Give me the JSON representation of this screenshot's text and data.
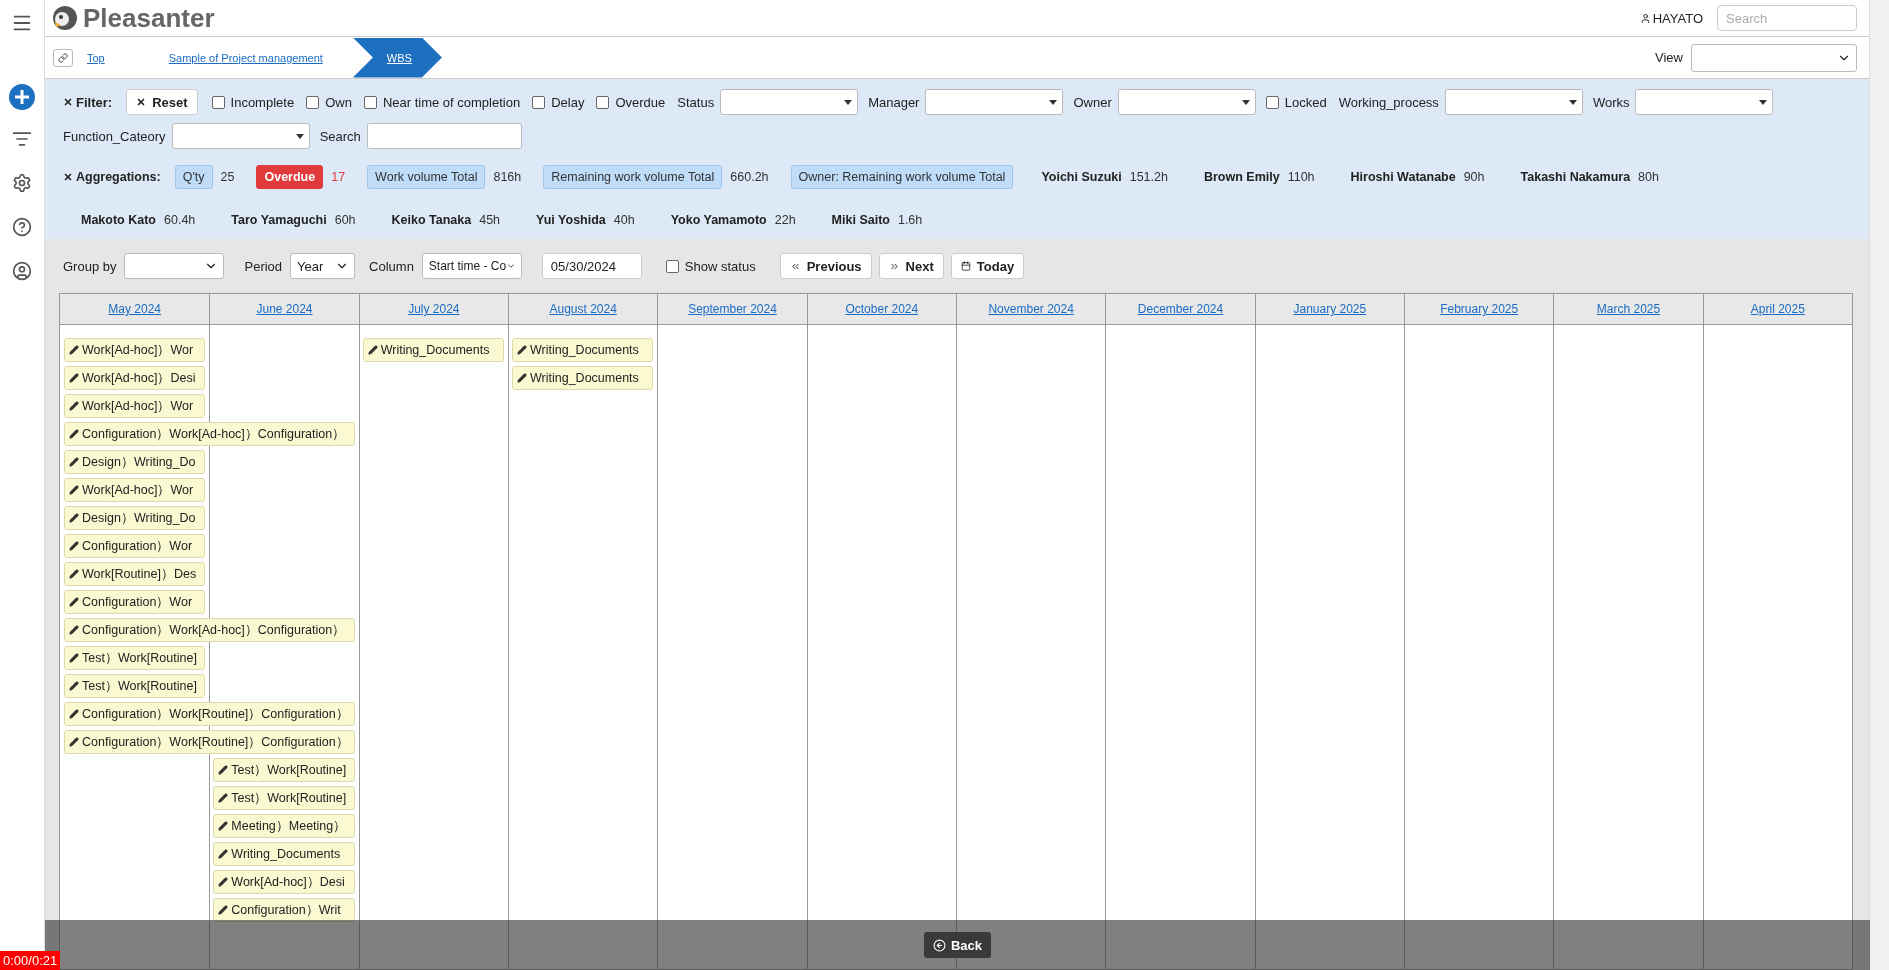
{
  "header": {
    "logo": "Pleasanter",
    "user": "HAYATO",
    "search_placeholder": "Search"
  },
  "breadcrumb": [
    {
      "label": "Top",
      "selected": false
    },
    {
      "label": "Sample of Project management",
      "selected": false
    },
    {
      "label": "WBS",
      "selected": true
    }
  ],
  "view": {
    "label": "View"
  },
  "filter": {
    "title": "Filter:",
    "reset": "Reset",
    "controls": [
      {
        "kind": "checkbox",
        "label": "Incomplete",
        "checked": false
      },
      {
        "kind": "checkbox",
        "label": "Own",
        "checked": false
      },
      {
        "kind": "checkbox",
        "label": "Near time of completion",
        "checked": false
      },
      {
        "kind": "checkbox",
        "label": "Delay",
        "checked": false
      },
      {
        "kind": "checkbox",
        "label": "Overdue",
        "checked": false
      },
      {
        "kind": "select",
        "label": "Status"
      },
      {
        "kind": "select",
        "label": "Manager"
      },
      {
        "kind": "select",
        "label": "Owner"
      },
      {
        "kind": "checkbox",
        "label": "Locked",
        "checked": false
      },
      {
        "kind": "select",
        "label": "Working_process"
      },
      {
        "kind": "select",
        "label": "Works"
      },
      {
        "kind": "select",
        "label": "Function_Cateory"
      },
      {
        "kind": "text",
        "label": "Search"
      }
    ]
  },
  "aggregations": {
    "title": "Aggregations:",
    "items": [
      {
        "kind": "tag",
        "label": "Q'ty",
        "value": "25"
      },
      {
        "kind": "alert",
        "label": "Overdue",
        "value": "17"
      },
      {
        "kind": "tag",
        "label": "Work volume Total",
        "value": "816h"
      },
      {
        "kind": "tag",
        "label": "Remaining work volume Total",
        "value": "660.2h"
      },
      {
        "kind": "tag",
        "label": "Owner: Remaining work volume Total",
        "value": ""
      },
      {
        "kind": "owner",
        "label": "Yoichi Suzuki",
        "value": "151.2h"
      },
      {
        "kind": "owner",
        "label": "Brown Emily",
        "value": "110h"
      },
      {
        "kind": "owner",
        "label": "Hiroshi Watanabe",
        "value": "90h"
      },
      {
        "kind": "owner",
        "label": "Takashi Nakamura",
        "value": "80h"
      },
      {
        "kind": "owner",
        "label": "Makoto Kato",
        "value": "60.4h"
      },
      {
        "kind": "owner",
        "label": "Taro Yamaguchi",
        "value": "60h"
      },
      {
        "kind": "owner",
        "label": "Keiko Tanaka",
        "value": "45h"
      },
      {
        "kind": "owner",
        "label": "Yui Yoshida",
        "value": "40h"
      },
      {
        "kind": "owner",
        "label": "Yoko Yamamoto",
        "value": "22h"
      },
      {
        "kind": "owner",
        "label": "Miki Saito",
        "value": "1.6h"
      }
    ]
  },
  "toolbar": {
    "group_by": {
      "label": "Group by"
    },
    "period": {
      "label": "Period",
      "value": "Year"
    },
    "column": {
      "label": "Column",
      "value": "Start time - Co"
    },
    "date": "05/30/2024",
    "show_status": {
      "label": "Show status",
      "checked": false
    },
    "buttons": [
      {
        "kind": "previous",
        "label": "Previous"
      },
      {
        "kind": "next",
        "label": "Next"
      },
      {
        "kind": "today",
        "label": "Today"
      }
    ]
  },
  "calendar": {
    "months": [
      "May 2024",
      "June 2024",
      "July 2024",
      "August 2024",
      "September 2024",
      "October 2024",
      "November 2024",
      "December 2024",
      "January 2025",
      "February 2025",
      "March 2025",
      "April 2025"
    ],
    "rows": [
      [
        {
          "kind": "single",
          "text": "Work[Ad-hoc]）Wor"
        },
        {
          "kind": "empty"
        },
        {
          "kind": "single",
          "text": "Writing_Documents"
        },
        {
          "kind": "single",
          "text": "Writing_Documents"
        }
      ],
      [
        {
          "kind": "single",
          "text": "Work[Ad-hoc]）Desi"
        },
        {
          "kind": "empty"
        },
        {
          "kind": "empty"
        },
        {
          "kind": "single",
          "text": "Writing_Documents"
        }
      ],
      [
        {
          "kind": "single",
          "text": "Work[Ad-hoc]）Wor"
        }
      ],
      [
        {
          "kind": "double",
          "text": "Configuration）Work[Ad-hoc]）Configuration）"
        }
      ],
      [
        {
          "kind": "single",
          "text": "Design）Writing_Do"
        }
      ],
      [
        {
          "kind": "single",
          "text": "Work[Ad-hoc]）Wor"
        }
      ],
      [
        {
          "kind": "single",
          "text": "Design）Writing_Do"
        }
      ],
      [
        {
          "kind": "single",
          "text": "Configuration）Wor"
        }
      ],
      [
        {
          "kind": "single",
          "text": "Work[Routine]）Des"
        }
      ],
      [
        {
          "kind": "single",
          "text": "Configuration）Wor"
        }
      ],
      [
        {
          "kind": "double",
          "text": "Configuration）Work[Ad-hoc]）Configuration）"
        }
      ],
      [
        {
          "kind": "single",
          "text": "Test）Work[Routine]"
        }
      ],
      [
        {
          "kind": "single",
          "text": "Test）Work[Routine]"
        }
      ],
      [
        {
          "kind": "double",
          "text": "Configuration）Work[Routine]）Configuration）"
        }
      ],
      [
        {
          "kind": "double",
          "text": "Configuration）Work[Routine]）Configuration）"
        }
      ],
      [
        {
          "kind": "empty"
        },
        {
          "kind": "single",
          "text": "Test）Work[Routine]"
        }
      ],
      [
        {
          "kind": "empty"
        },
        {
          "kind": "single",
          "text": "Test）Work[Routine]"
        }
      ],
      [
        {
          "kind": "empty"
        },
        {
          "kind": "single",
          "text": "Meeting）Meeting）"
        }
      ],
      [
        {
          "kind": "empty"
        },
        {
          "kind": "single",
          "text": "Writing_Documents"
        }
      ],
      [
        {
          "kind": "empty"
        },
        {
          "kind": "single",
          "text": "Work[Ad-hoc]）Desi"
        }
      ],
      [
        {
          "kind": "empty"
        },
        {
          "kind": "single",
          "text": "Configuration）Writ"
        }
      ]
    ]
  },
  "player": {
    "back": "Back",
    "time": "0:00/0:21"
  }
}
